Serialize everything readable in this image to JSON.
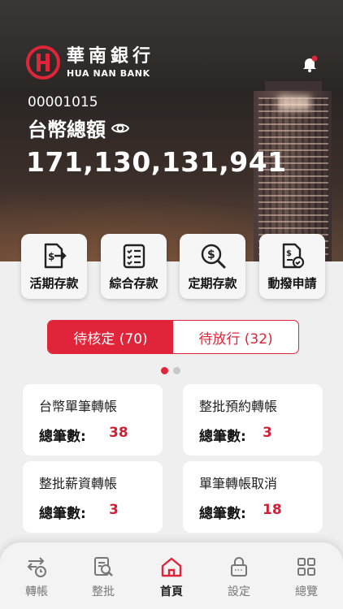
{
  "brand": {
    "name_cn": "華南銀行",
    "name_en": "HUA NAN BANK",
    "color": "#e0243a"
  },
  "account": {
    "number": "00001015",
    "total_label": "台幣總額",
    "total_value": "171,130,131,941"
  },
  "shortcuts": [
    {
      "label": "活期存款",
      "icon": "document-transfer-icon"
    },
    {
      "label": "綜合存款",
      "icon": "checklist-icon"
    },
    {
      "label": "定期存款",
      "icon": "dollar-search-icon"
    },
    {
      "label": "動撥申請",
      "icon": "document-check-icon"
    }
  ],
  "tabs": [
    {
      "label": "待核定 (70)",
      "active": true
    },
    {
      "label": "待放行 (32)",
      "active": false
    }
  ],
  "pager": {
    "current": 1,
    "total": 2
  },
  "cards": [
    {
      "title": "台幣單筆轉帳",
      "count_label": "總筆數:",
      "count": "38"
    },
    {
      "title": "整批預約轉帳",
      "count_label": "總筆數:",
      "count": "3"
    },
    {
      "title": "整批薪資轉帳",
      "count_label": "總筆數:",
      "count": "3"
    },
    {
      "title": "單筆轉帳取消",
      "count_label": "總筆數:",
      "count": "18"
    }
  ],
  "nav": [
    {
      "label": "轉帳",
      "icon": "transfer-icon",
      "active": false
    },
    {
      "label": "整批",
      "icon": "batch-search-icon",
      "active": false
    },
    {
      "label": "首頁",
      "icon": "home-icon",
      "active": true
    },
    {
      "label": "設定",
      "icon": "lock-icon",
      "active": false
    },
    {
      "label": "總覽",
      "icon": "grid-icon",
      "active": false
    }
  ]
}
